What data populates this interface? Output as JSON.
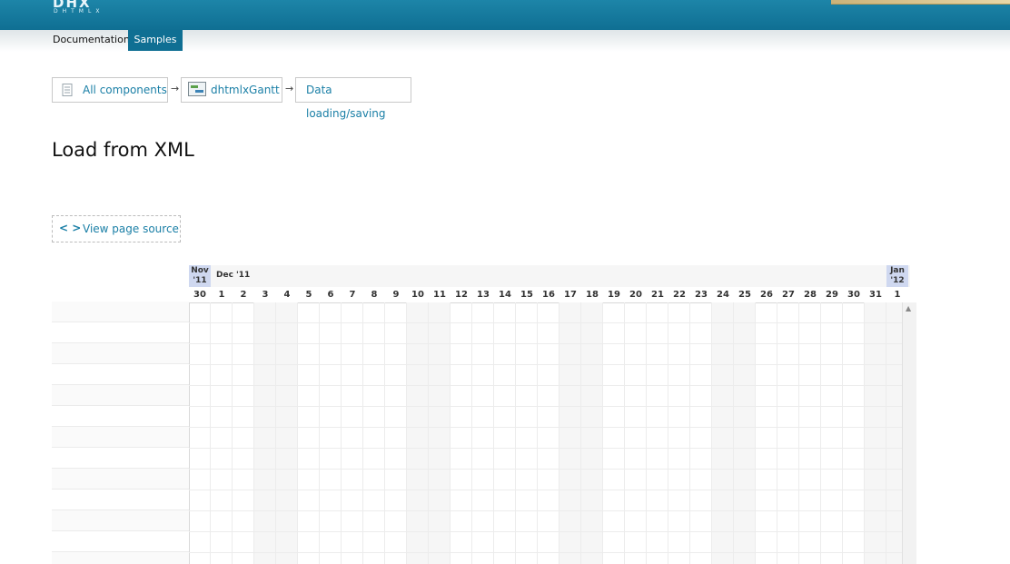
{
  "header": {
    "logo_text": "DHX",
    "logo_sub": "DHTMLX",
    "nav": {
      "documentation": "Documentation",
      "samples": "Samples"
    }
  },
  "breadcrumbs": [
    {
      "label": "All components",
      "icon": "document-icon"
    },
    {
      "label": "dhtmlxGantt",
      "icon": "gantt-icon"
    },
    {
      "label": "Data loading/saving"
    }
  ],
  "breadcrumb_separator": "→",
  "page_title": "Load from XML",
  "view_source": {
    "icon_text": "< >",
    "label": "View page source"
  },
  "gantt": {
    "months": [
      {
        "label": "Nov\n'11",
        "highlight": true
      },
      {
        "label": "Dec '11",
        "highlight": false
      },
      {
        "label": "Jan\n'12",
        "highlight": true
      }
    ],
    "days": [
      "30",
      "1",
      "2",
      "3",
      "4",
      "5",
      "6",
      "7",
      "8",
      "9",
      "10",
      "11",
      "12",
      "13",
      "14",
      "15",
      "16",
      "17",
      "18",
      "19",
      "20",
      "21",
      "22",
      "23",
      "24",
      "25",
      "26",
      "27",
      "28",
      "29",
      "30",
      "31",
      "1"
    ],
    "weekend_indices": [
      3,
      4,
      10,
      11,
      17,
      18,
      24,
      25,
      31,
      32
    ],
    "scroll_up_symbol": "▲"
  },
  "colors": {
    "header": "#1d85a8",
    "accent": "#0f6f93",
    "link": "#1a7fa6",
    "month_highlight": "#cfd8f0"
  }
}
